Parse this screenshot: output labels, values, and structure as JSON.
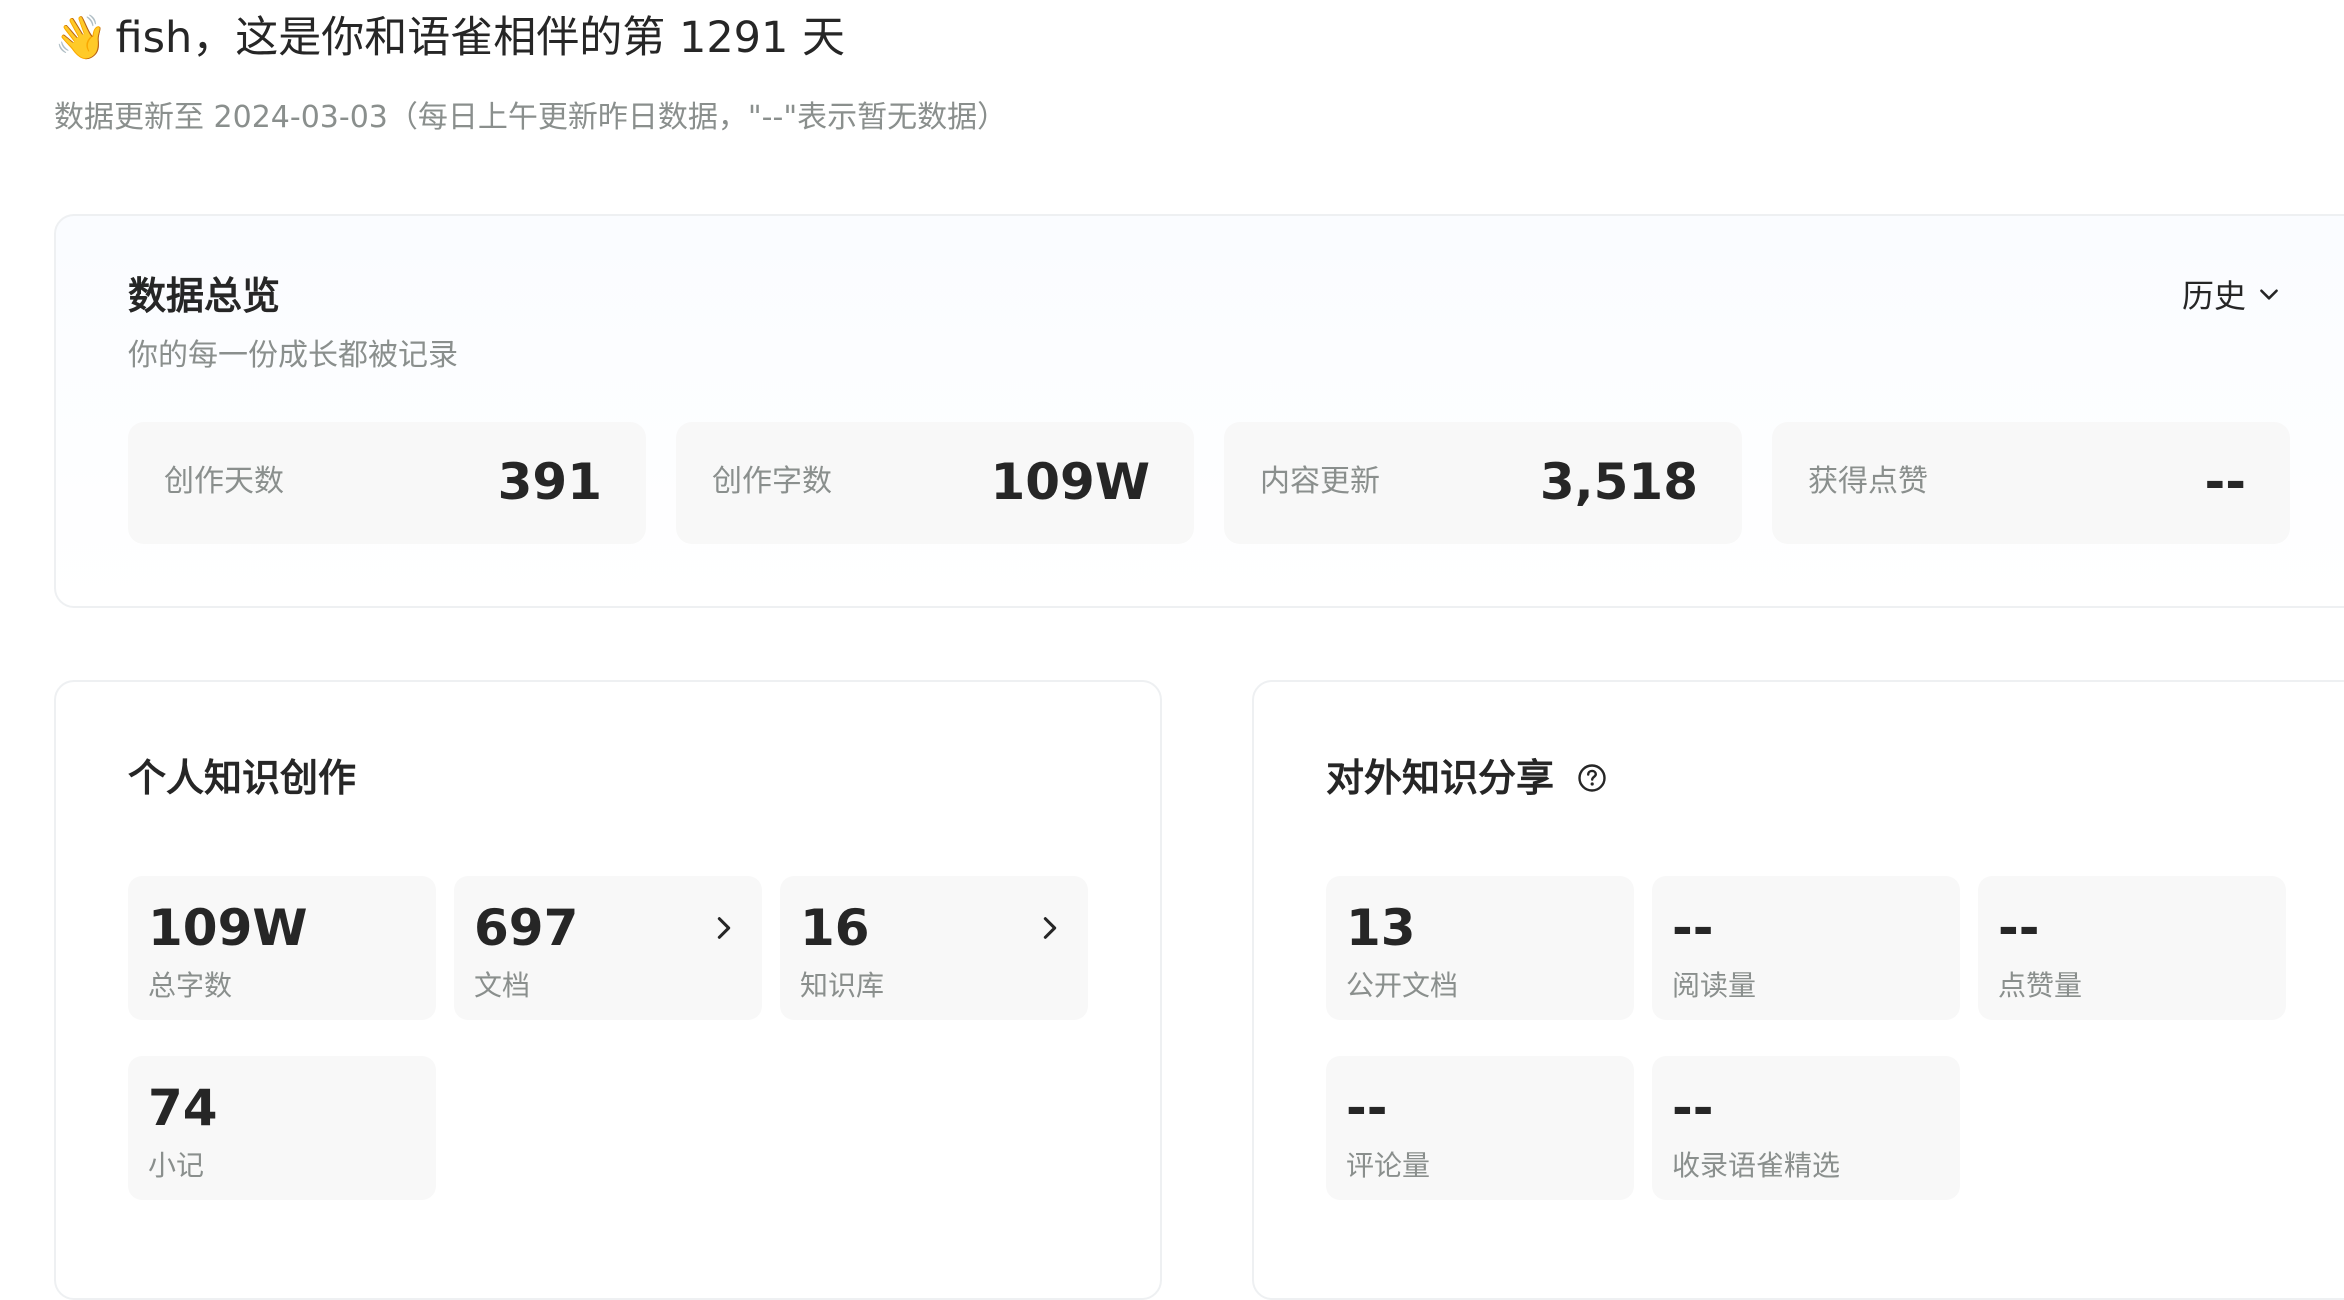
{
  "header": {
    "wave_emoji": "👋",
    "greeting": "fish，这是你和语雀相伴的第 1291 天",
    "update_note": "数据更新至 2024-03-03（每日上午更新昨日数据，\"--\"表示暂无数据）"
  },
  "overview": {
    "title": "数据总览",
    "subtitle": "你的每一份成长都被记录",
    "period_selector": "历史",
    "stats": [
      {
        "label": "创作天数",
        "value": "391"
      },
      {
        "label": "创作字数",
        "value": "109W"
      },
      {
        "label": "内容更新",
        "value": "3,518"
      },
      {
        "label": "获得点赞",
        "value": "--"
      }
    ]
  },
  "personal": {
    "title": "个人知识创作",
    "tiles": [
      {
        "value": "109W",
        "label": "总字数"
      },
      {
        "value": "697",
        "label": "文档"
      },
      {
        "value": "16",
        "label": "知识库"
      },
      {
        "value": "74",
        "label": "小记"
      }
    ]
  },
  "sharing": {
    "title": "对外知识分享",
    "help_icon": "question-circle-icon",
    "tiles": [
      {
        "value": "13",
        "label": "公开文档"
      },
      {
        "value": "--",
        "label": "阅读量"
      },
      {
        "value": "--",
        "label": "点赞量"
      },
      {
        "value": "--",
        "label": "评论量"
      },
      {
        "value": "--",
        "label": "收录语雀精选"
      }
    ]
  },
  "icons": {
    "period_dropdown": "chevron-down-icon",
    "tile_link": "chevron-right-icon"
  }
}
